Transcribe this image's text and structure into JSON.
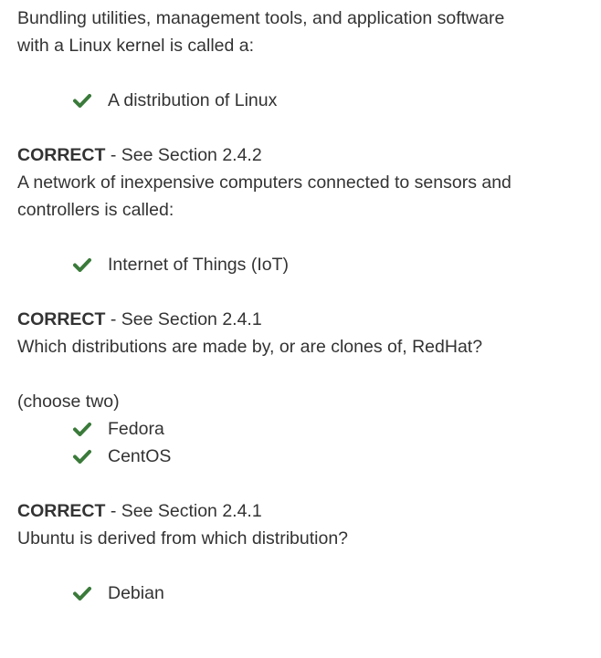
{
  "intro_question": {
    "lines": [
      "Bundling utilities, management tools, and application software",
      "with a Linux kernel is called a:"
    ],
    "answers": [
      "A distribution of Linux"
    ]
  },
  "results": [
    {
      "status": "CORRECT",
      "reference": " - See Section 2.4.2",
      "next_question_lines": [
        "A network of inexpensive computers connected to sensors and",
        "controllers is called:"
      ],
      "next_note": "",
      "next_answers": [
        "Internet of Things (IoT)"
      ]
    },
    {
      "status": "CORRECT",
      "reference": " - See Section 2.4.1",
      "next_question_lines": [
        "Which distributions are made by, or are clones of, RedHat?"
      ],
      "next_note": "(choose two)",
      "next_answers": [
        "Fedora",
        "CentOS"
      ]
    },
    {
      "status": "CORRECT",
      "reference": " - See Section 2.4.1",
      "next_question_lines": [
        "Ubuntu is derived from which distribution?"
      ],
      "next_note": "",
      "next_answers": [
        "Debian"
      ]
    }
  ],
  "colors": {
    "text": "#333333",
    "check": "#3a7a3a"
  },
  "icons": {
    "answer_marker": "checkmark-icon"
  }
}
